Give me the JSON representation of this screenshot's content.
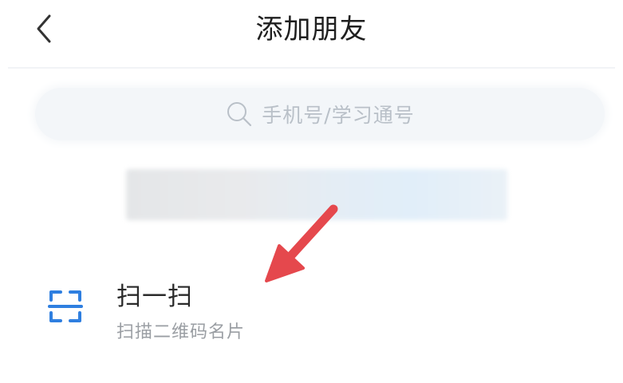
{
  "header": {
    "title": "添加朋友",
    "back_icon": "chevron-left-icon"
  },
  "search": {
    "placeholder": "手机号/学习通号",
    "icon": "search-icon"
  },
  "scan": {
    "title": "扫一扫",
    "subtitle": "扫描二维码名片",
    "icon": "qr-scan-icon",
    "icon_color": "#2f7fe0"
  },
  "annotation": {
    "arrow_color": "#e5484d"
  }
}
